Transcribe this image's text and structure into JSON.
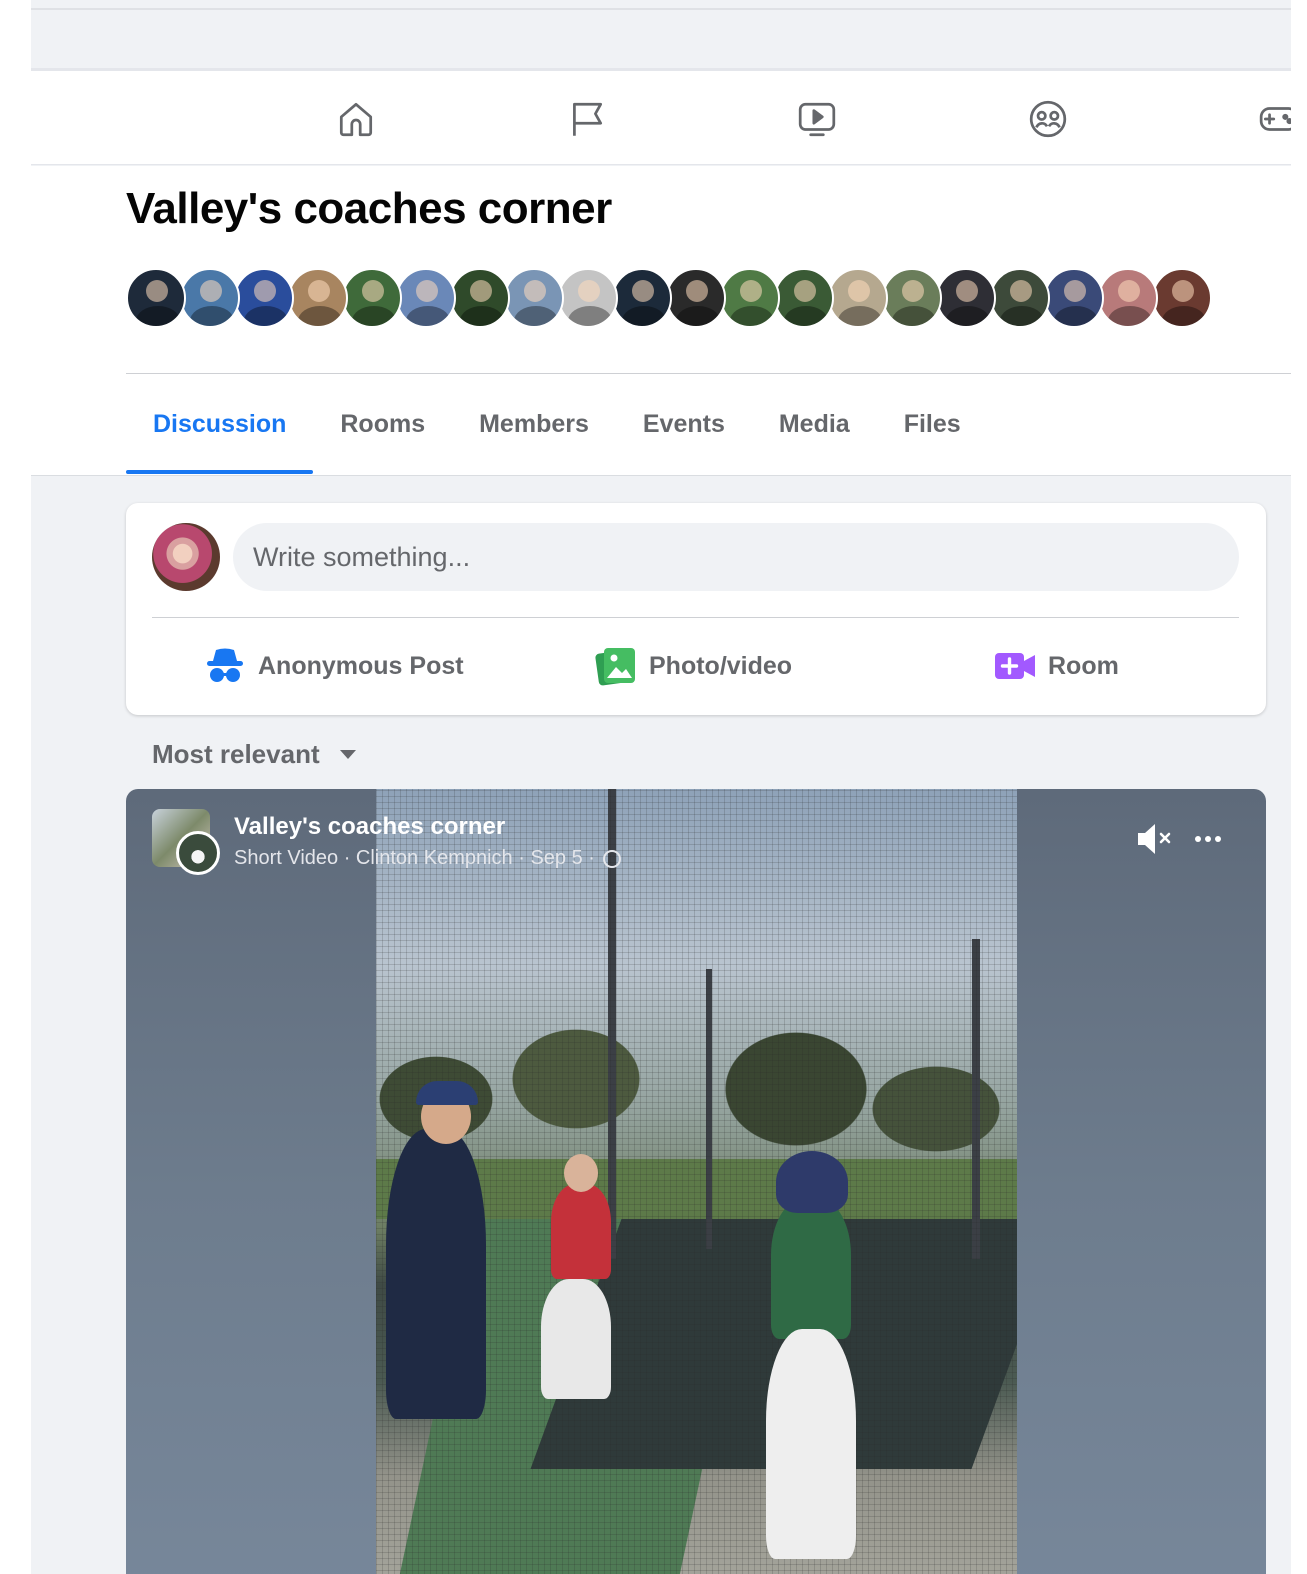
{
  "nav": {
    "icons": [
      "home-icon",
      "pages-flag-icon",
      "watch-video-icon",
      "groups-icon",
      "gaming-icon"
    ]
  },
  "group": {
    "title": "Valley's coaches corner",
    "member_avatar_colors": [
      "#1e2a3a",
      "#4a78a8",
      "#2a4d9c",
      "#a88560",
      "#3f6a3a",
      "#6a88b8",
      "#2f4a2a",
      "#7a95b5",
      "#c4c4c4",
      "#1c2a3a",
      "#2a2a2a",
      "#4f7a45",
      "#3a5a35",
      "#b5a88f",
      "#6a7d5a",
      "#2e2e35",
      "#3d4a3a",
      "#3a4a78",
      "#b87a7a",
      "#6a3a30"
    ]
  },
  "tabs": [
    {
      "label": "Discussion",
      "active": true
    },
    {
      "label": "Rooms",
      "active": false
    },
    {
      "label": "Members",
      "active": false
    },
    {
      "label": "Events",
      "active": false
    },
    {
      "label": "Media",
      "active": false
    },
    {
      "label": "Files",
      "active": false
    }
  ],
  "composer": {
    "placeholder": "Write something...",
    "actions": {
      "anonymous": "Anonymous Post",
      "photo": "Photo/video",
      "room": "Room"
    },
    "colors": {
      "anonymous": "#1877f2",
      "photo": "#45bd62",
      "room": "#a259ff"
    }
  },
  "feed": {
    "sort_label": "Most relevant"
  },
  "post": {
    "group_name": "Valley's coaches corner",
    "meta": "Short Video · Clinton Kempnich · Sep 5 ·",
    "audience_icon": "globe-icon",
    "sound_icon": "muted-speaker-icon",
    "menu_icon": "more-options-icon"
  }
}
